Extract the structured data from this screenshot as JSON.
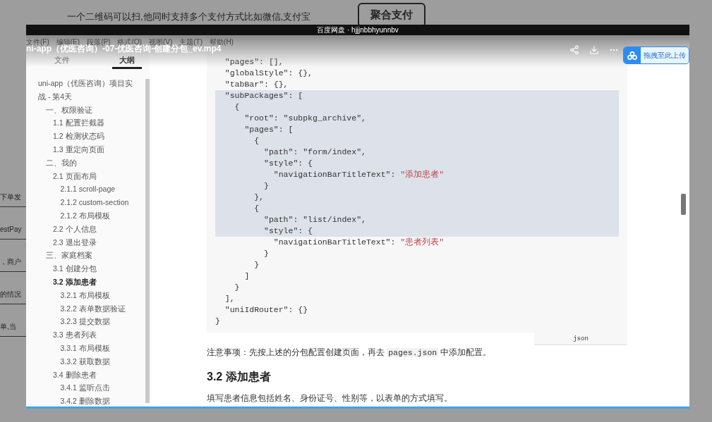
{
  "background": {
    "caption": "一个二维码可以扫,他同时支持多个支付方式比如微信,支付宝",
    "node": "聚合支付",
    "fragments": [
      "下单发",
      "estPay",
      "，商户",
      "的情况",
      "单,当"
    ]
  },
  "window": {
    "title": "百度网盘 · hjjjnbbhyunnbv",
    "video_title": "ni-app（优医咨询）-07-优医咨询-创建分包_ev.mp4",
    "upload_button": "拖拽至此上传",
    "progress": {
      "level": 1
    }
  },
  "menu": [
    "文件(F)",
    "编辑(E)",
    "段落(P)",
    "格式(O)",
    "视图(V)",
    "主题(T)",
    "帮助(H)"
  ],
  "sidebar": {
    "tabs": [
      {
        "label": "文件",
        "selected": false
      },
      {
        "label": "大纲",
        "selected": true
      }
    ],
    "outline": [
      {
        "label": "uni-app（优医咨询）项目实战 - 第4天",
        "selected": false,
        "children": [
          {
            "label": "一、权限验证",
            "selected": false,
            "children": [
              {
                "label": "1.1 配置拦截器",
                "selected": false
              },
              {
                "label": "1.2 检测状态码",
                "selected": false
              },
              {
                "label": "1.3 重定向页面",
                "selected": false
              }
            ]
          },
          {
            "label": "二、我的",
            "selected": false,
            "children": [
              {
                "label": "2.1 页面布局",
                "selected": false,
                "children": [
                  {
                    "label": "2.1.1 scroll-page",
                    "selected": false
                  },
                  {
                    "label": "2.1.2 custom-section",
                    "selected": false
                  },
                  {
                    "label": "2.1.2 布局模板",
                    "selected": false
                  }
                ]
              },
              {
                "label": "2.2 个人信息",
                "selected": false
              },
              {
                "label": "2.3 退出登录",
                "selected": false
              }
            ]
          },
          {
            "label": "三、家庭档案",
            "selected": false,
            "children": [
              {
                "label": "3.1 创建分包",
                "selected": false
              },
              {
                "label": "3.2 添加患者",
                "selected": true,
                "children": [
                  {
                    "label": "3.2.1 布局模板",
                    "selected": false
                  },
                  {
                    "label": "3.2.2 表单数据验证",
                    "selected": false
                  },
                  {
                    "label": "3.2.3 提交数据",
                    "selected": false
                  }
                ]
              },
              {
                "label": "3.3 患者列表",
                "selected": false,
                "children": [
                  {
                    "label": "3.3.1 布局模板",
                    "selected": false
                  },
                  {
                    "label": "3.3.2 获取数据",
                    "selected": false
                  }
                ]
              },
              {
                "label": "3.4 删除患者",
                "selected": false,
                "children": [
                  {
                    "label": "3.4.1 监听点击",
                    "selected": false
                  },
                  {
                    "label": "3.4.2 删除数据",
                    "selected": false
                  }
                ]
              }
            ]
          }
        ]
      }
    ]
  },
  "code": {
    "language": "json",
    "lines": [
      {
        "text": "  \"pages\": [],",
        "selected": false
      },
      {
        "text": "  \"globalStyle\": {},",
        "selected": false
      },
      {
        "text": "  \"tabBar\": {},",
        "selected": false
      },
      {
        "text": "  \"subPackages\": [",
        "selected": true
      },
      {
        "text": "    {",
        "selected": true
      },
      {
        "text": "      \"root\": \"subpkg_archive\",",
        "selected": true
      },
      {
        "text": "      \"pages\": [",
        "selected": true
      },
      {
        "text": "        {",
        "selected": true
      },
      {
        "text": "          \"path\": \"form/index\",",
        "selected": true
      },
      {
        "text": "          \"style\": {",
        "selected": true
      },
      {
        "text": "            \"navigationBarTitleText\": ",
        "string": "\"添加患者\"",
        "selected": true
      },
      {
        "text": "          }",
        "selected": true
      },
      {
        "text": "        },",
        "selected": true
      },
      {
        "text": "        {",
        "selected": true
      },
      {
        "text": "          \"path\": \"list/index\",",
        "selected": true
      },
      {
        "text": "          \"style\": {",
        "selected": true
      },
      {
        "text": "            \"navigationBarTitleText\": ",
        "string": "\"患者列表\"",
        "selected": false
      },
      {
        "text": "          }",
        "selected": false
      },
      {
        "text": "        }",
        "selected": false
      },
      {
        "text": "      ]",
        "selected": false
      },
      {
        "text": "    }",
        "selected": false
      },
      {
        "text": "  ],",
        "selected": false
      },
      {
        "text": "  \"uniIdRouter\": {}",
        "selected": false
      },
      {
        "text": "}",
        "selected": false
      }
    ]
  },
  "note": {
    "before": "注意事项：先按上述的分包配置创建页面，再去 ",
    "code": "pages.json",
    "after": " 中添加配置。"
  },
  "heading": "3.2 添加患者",
  "paragraph": "填写患者信息包括姓名、身份证号、性别等，以表单的方式填写。"
}
